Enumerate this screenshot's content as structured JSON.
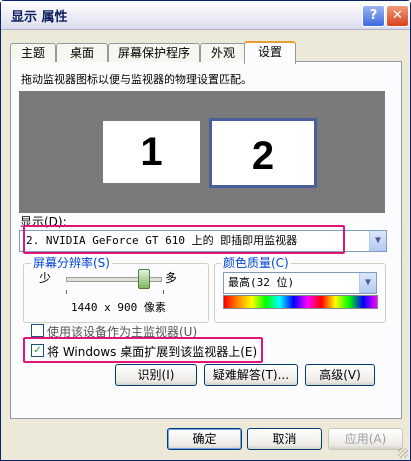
{
  "window": {
    "title": "显示 属性",
    "help_label": "?",
    "close_label": "✕"
  },
  "tabs": [
    {
      "label": "主题"
    },
    {
      "label": "桌面"
    },
    {
      "label": "屏幕保护程序"
    },
    {
      "label": "外观"
    },
    {
      "label": "设置",
      "active": true
    }
  ],
  "settings": {
    "description": "拖动监视器图标以便与监视器的物理设置匹配。",
    "monitors": [
      {
        "label": "1"
      },
      {
        "label": "2",
        "selected": true
      }
    ],
    "display_label": "显示(D):",
    "display_value": "2. NVIDIA GeForce GT 610 上的 即插即用监视器",
    "resolution": {
      "title": "屏幕分辨率(S)",
      "less_label": "少",
      "more_label": "多",
      "value": "1440 x 900 像素",
      "slider_fraction": 0.85
    },
    "color_quality": {
      "title": "颜色质量(C)",
      "value": "最高(32 位)"
    },
    "primary_checkbox": {
      "label": "使用该设备作为主监视器(U)",
      "checked": false
    },
    "extend_checkbox": {
      "label": "将 Windows 桌面扩展到该监视器上(E)",
      "checked": true
    },
    "buttons": {
      "identify": "识别(I)",
      "troubleshoot": "疑难解答(T)...",
      "advanced": "高级(V)"
    }
  },
  "footer": {
    "ok": "确定",
    "cancel": "取消",
    "apply": "应用(A)"
  },
  "colors": {
    "highlight": "#e0157a",
    "accent_blue": "#0046d5"
  }
}
